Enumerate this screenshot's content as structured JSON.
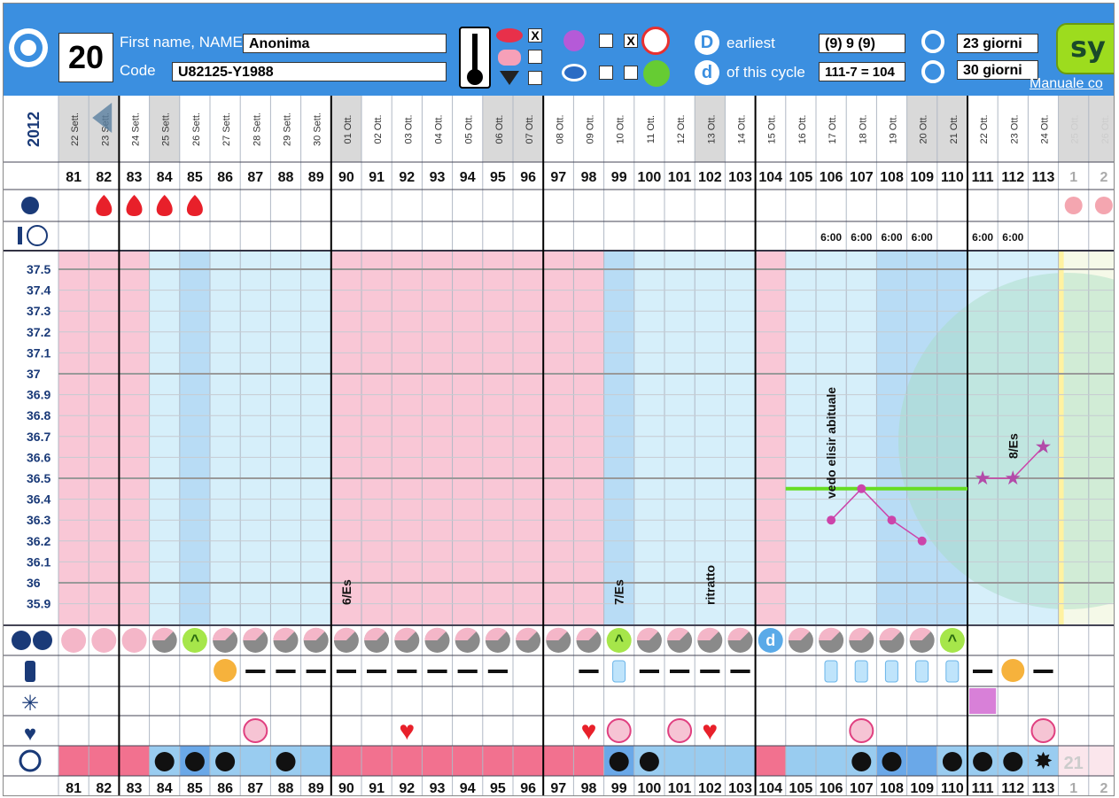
{
  "header": {
    "cycle_number": "20",
    "name_label": "First name, NAME",
    "name_value": "Anonima",
    "code_label": "Code",
    "code_value": "U82125-Y1988",
    "earliest_label": "earliest",
    "this_cycle_label": "of this cycle",
    "earliest_value": "(9) 9 (9)",
    "this_cycle_value": "111-7 = 104",
    "cycle_len_1": "23 giorni",
    "cycle_len_2": "30 giorni",
    "manual_link": "Manuale co",
    "brand": "sy",
    "checkbox_marks": {
      "mouth": "X",
      "mood": "X"
    }
  },
  "year": "2012",
  "days": [
    {
      "date": "22 Sett.",
      "n": "81"
    },
    {
      "date": "23 Sett.",
      "n": "82"
    },
    {
      "date": "24 Sett.",
      "n": "83"
    },
    {
      "date": "25 Sett.",
      "n": "84"
    },
    {
      "date": "26 Sett.",
      "n": "85"
    },
    {
      "date": "27 Sett.",
      "n": "86"
    },
    {
      "date": "28 Sett.",
      "n": "87"
    },
    {
      "date": "29 Sett.",
      "n": "88"
    },
    {
      "date": "30 Sett.",
      "n": "89"
    },
    {
      "date": "01 Ott.",
      "n": "90"
    },
    {
      "date": "02 Ott.",
      "n": "91"
    },
    {
      "date": "03 Ott.",
      "n": "92"
    },
    {
      "date": "04 Ott.",
      "n": "93"
    },
    {
      "date": "05 Ott.",
      "n": "94"
    },
    {
      "date": "06 Ott.",
      "n": "95"
    },
    {
      "date": "07 Ott.",
      "n": "96"
    },
    {
      "date": "08 Ott.",
      "n": "97"
    },
    {
      "date": "09 Ott.",
      "n": "98"
    },
    {
      "date": "10 Ott.",
      "n": "99"
    },
    {
      "date": "11 Ott.",
      "n": "100"
    },
    {
      "date": "12 Ott.",
      "n": "101"
    },
    {
      "date": "13 Ott.",
      "n": "102"
    },
    {
      "date": "14 Ott.",
      "n": "103"
    },
    {
      "date": "15 Ott.",
      "n": "104"
    },
    {
      "date": "16 Ott.",
      "n": "105"
    },
    {
      "date": "17 Ott.",
      "n": "106"
    },
    {
      "date": "18 Ott.",
      "n": "107"
    },
    {
      "date": "19 Ott.",
      "n": "108"
    },
    {
      "date": "20 Ott.",
      "n": "109"
    },
    {
      "date": "21 Ott.",
      "n": "110"
    },
    {
      "date": "22 Ott.",
      "n": "111"
    },
    {
      "date": "23 Ott.",
      "n": "112"
    },
    {
      "date": "24 Ott.",
      "n": "113"
    },
    {
      "date": "25 Ott.",
      "n": "1"
    },
    {
      "date": "26 Ott.",
      "n": "2"
    }
  ],
  "grey_date_columns": [
    0,
    1,
    3,
    9,
    14,
    15,
    21,
    28,
    29,
    33,
    34
  ],
  "cycle_dividers_after": [
    1,
    8,
    15,
    22,
    29
  ],
  "temp_axis": [
    "37.5",
    "37.4",
    "37.3",
    "37.2",
    "37.1",
    "37",
    "36.9",
    "36.8",
    "36.7",
    "36.6",
    "36.5",
    "36.4",
    "36.3",
    "36.2",
    "36.1",
    "36",
    "35.9"
  ],
  "bleeding_days": [
    1,
    2,
    3,
    4
  ],
  "time_readings": [
    {
      "col": 25,
      "text": "6:00"
    },
    {
      "col": 26,
      "text": "6:00"
    },
    {
      "col": 27,
      "text": "6:00"
    },
    {
      "col": 28,
      "text": "6:00"
    },
    {
      "col": 30,
      "text": "6:00"
    },
    {
      "col": 31,
      "text": "6:00"
    }
  ],
  "temperatures": [
    {
      "col": 25,
      "t": 36.3
    },
    {
      "col": 26,
      "t": 36.45
    },
    {
      "col": 27,
      "t": 36.3
    },
    {
      "col": 28,
      "t": 36.2
    }
  ],
  "temperatures_star": [
    {
      "col": 30,
      "t": 36.5
    },
    {
      "col": 31,
      "t": 36.5
    },
    {
      "col": 32,
      "t": 36.65
    }
  ],
  "coverline": 36.45,
  "annotations": [
    {
      "col": 9,
      "text": "6/Es"
    },
    {
      "col": 18,
      "text": "7/Es"
    },
    {
      "col": 21,
      "text": "ritratto"
    },
    {
      "col": 25,
      "text": "vedo elisir abituale"
    },
    {
      "col": 31,
      "text": "8/Es"
    }
  ],
  "bottom_labels": {
    "next_cycle": "21"
  },
  "colors": {
    "header_blue": "#3b8fe0",
    "pink": "#f9c7d6",
    "light_blue": "#d6effa",
    "mid_blue": "#b8dcf5",
    "temp_line": "#cc44aa",
    "coverline": "#66dd22",
    "bottom_pink": "#f2718f",
    "bottom_blue": "#99ccf0"
  }
}
